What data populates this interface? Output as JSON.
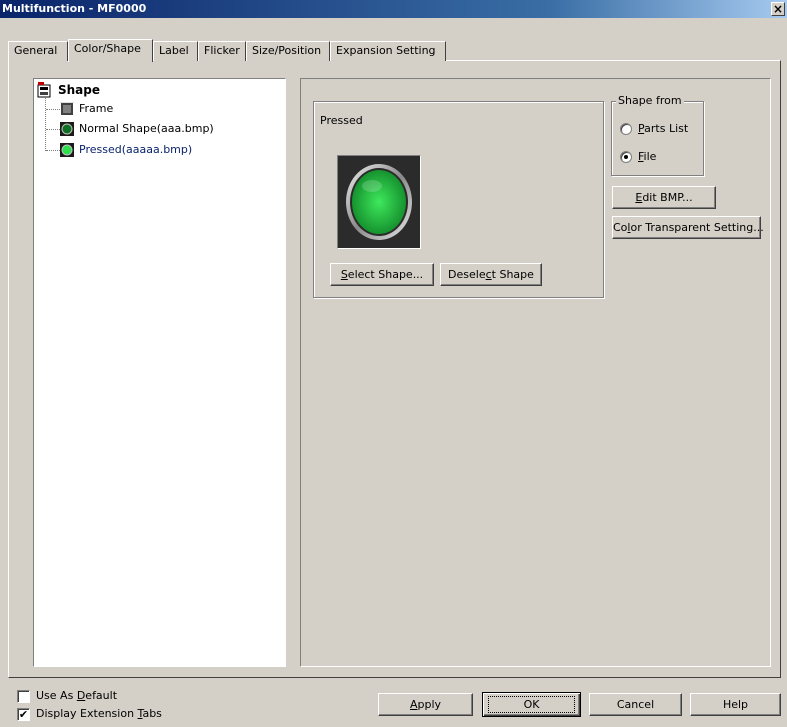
{
  "window": {
    "title": "Multifunction - MF0000",
    "close_glyph": "×"
  },
  "tabs": [
    {
      "label": "General"
    },
    {
      "label": "Color/Shape"
    },
    {
      "label": "Label"
    },
    {
      "label": "Flicker"
    },
    {
      "label": "Size/Position"
    },
    {
      "label": "Expansion Setting"
    }
  ],
  "active_tab": "Color/Shape",
  "tree": {
    "root": "Shape",
    "items": [
      {
        "label": "Frame",
        "icon": "frame-icon"
      },
      {
        "label": "Normal Shape(aaa.bmp)",
        "icon": "green-button-icon"
      },
      {
        "label": "Pressed(aaaaa.bmp)",
        "icon": "green-lit-button-icon",
        "selected": true
      }
    ]
  },
  "preview": {
    "group_label": "Pressed",
    "select_button": {
      "prefix": "",
      "hotkey": "S",
      "rest": "elect Shape..."
    },
    "deselect_button": {
      "prefix": "Desele",
      "hotkey": "c",
      "rest": "t Shape"
    },
    "colors": {
      "lamp": "#3ee85c",
      "lamp_dark": "#128a2a",
      "ring": "#c8c8c8"
    }
  },
  "shape_from": {
    "title": "Shape from",
    "options": [
      {
        "hotkey": "P",
        "rest": "arts List",
        "checked": false
      },
      {
        "hotkey": "F",
        "rest": "ile",
        "checked": true
      }
    ]
  },
  "buttons": {
    "edit_bmp": {
      "hotkey": "E",
      "rest": "dit BMP..."
    },
    "color_transparent": {
      "prefix": "Co",
      "hotkey": "l",
      "rest": "or Transparent Setting..."
    },
    "apply": {
      "hotkey": "A",
      "rest": "pply"
    },
    "ok": "OK",
    "cancel": "Cancel",
    "help": "Help"
  },
  "footer": {
    "use_as_default": {
      "prefix": "Use As ",
      "hotkey": "D",
      "rest": "efault",
      "checked": false
    },
    "display_extension_tabs": {
      "prefix": "Display Extension ",
      "hotkey": "T",
      "rest": "abs",
      "checked": true,
      "check_glyph": "✔"
    }
  }
}
